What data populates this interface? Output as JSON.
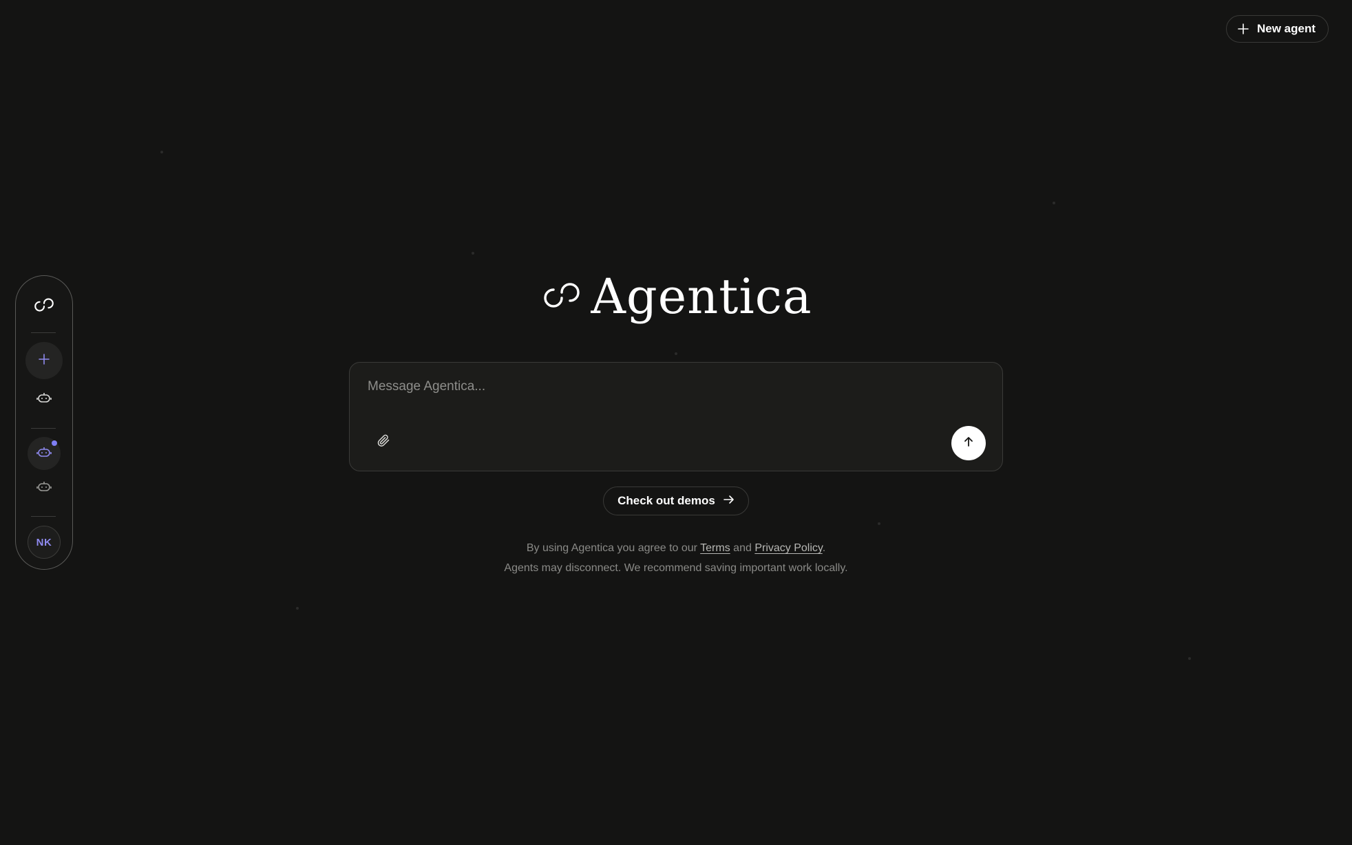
{
  "header": {
    "new_agent_label": "New agent",
    "new_agent_icon": "plus-icon"
  },
  "sidebar": {
    "logo_icon": "agentica-logo-icon",
    "new_button_icon": "plus-icon",
    "agents": [
      {
        "icon": "robot-icon",
        "active": false
      },
      {
        "icon": "robot-icon",
        "active": true,
        "status": "online"
      },
      {
        "icon": "robot-icon",
        "active": false
      }
    ],
    "avatar_initials": "NK"
  },
  "brand": {
    "name": "Agentica"
  },
  "composer": {
    "placeholder": "Message Agentica...",
    "value": "",
    "attach_icon": "paperclip-icon",
    "send_icon": "arrow-up-icon"
  },
  "demos": {
    "label": "Check out demos",
    "icon": "arrow-right-icon"
  },
  "legal": {
    "prefix": "By using Agentica you agree to our ",
    "terms_label": "Terms",
    "middle": " and ",
    "privacy_label": "Privacy Policy",
    "suffix": ".",
    "notice": "Agents may disconnect. We recommend saving important work locally."
  },
  "colors": {
    "background": "#141413",
    "accent": "#8f8af0",
    "status_dot": "#7f7ff5",
    "muted_text": "#8a8a87"
  }
}
